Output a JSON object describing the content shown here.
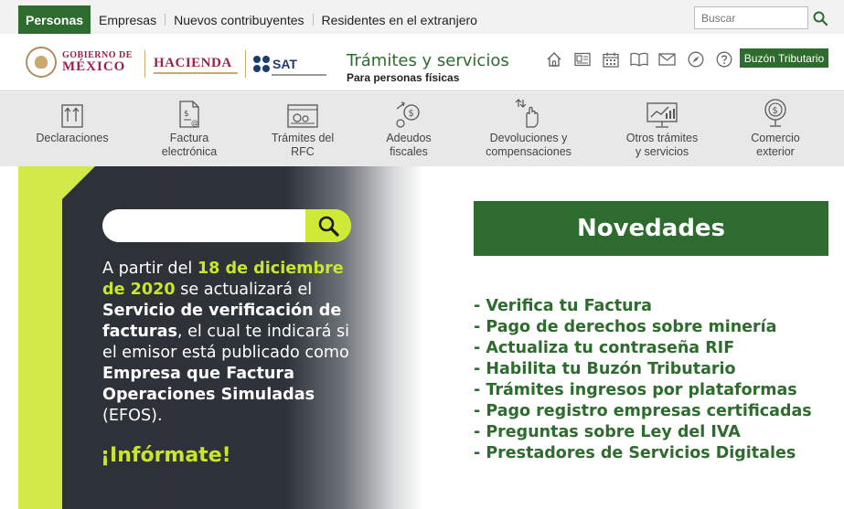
{
  "topnav": {
    "items": [
      {
        "label": "Personas",
        "active": true
      },
      {
        "label": "Empresas",
        "active": false
      },
      {
        "label": "Nuevos contribuyentes",
        "active": false
      },
      {
        "label": "Residentes en el extranjero",
        "active": false
      }
    ],
    "search_placeholder": "Buscar"
  },
  "header": {
    "gob_line1": "GOBIERNO DE",
    "gob_line2": "MÉXICO",
    "hacienda": "HACIENDA",
    "sat": "SAT",
    "title": "Trámites y servicios",
    "subtitle": "Para personas físicas",
    "icons": [
      "home-icon",
      "id-card-icon",
      "calendar-icon",
      "book-icon",
      "mail-icon",
      "compass-icon",
      "help-icon"
    ],
    "buzon_label": "Buzón Tributario"
  },
  "categories": [
    {
      "label": "Declaraciones",
      "icon": "declaraciones-icon"
    },
    {
      "label": "Factura\nelectrónica",
      "icon": "factura-icon"
    },
    {
      "label": "Trámites del\nRFC",
      "icon": "rfc-icon"
    },
    {
      "label": "Adeudos\nfiscales",
      "icon": "adeudos-icon"
    },
    {
      "label": "Devoluciones y\ncompensaciones",
      "icon": "devoluciones-icon"
    },
    {
      "label": "Otros trámites\ny servicios",
      "icon": "otros-tramites-icon"
    },
    {
      "label": "Comercio\nexterior",
      "icon": "comercio-exterior-icon"
    }
  ],
  "hero": {
    "t1": "A partir del ",
    "date": "18 de diciembre de 2020",
    "t2": " se actualizará el ",
    "service": "Servicio de verificación de facturas",
    "t3": ", el cual te indicará si el emisor está publicado como ",
    "empresa": "Empresa que Factura Operaciones Simuladas",
    "t4": " (EFOS).",
    "cta": "¡Infórmate!",
    "accent_color": "#c8e62c"
  },
  "novedades": {
    "title": "Novedades",
    "items": [
      "- Verifica tu Factura",
      "- Pago de derechos sobre minería",
      "- Actualiza tu contraseña RIF",
      "- Habilita tu Buzón Tributario",
      "- Trámites ingresos por plataformas",
      "- Pago registro empresas certificadas",
      "- Preguntas sobre Ley del IVA",
      "- Prestadores de Servicios Digitales"
    ],
    "color": "#2e6b2e"
  }
}
